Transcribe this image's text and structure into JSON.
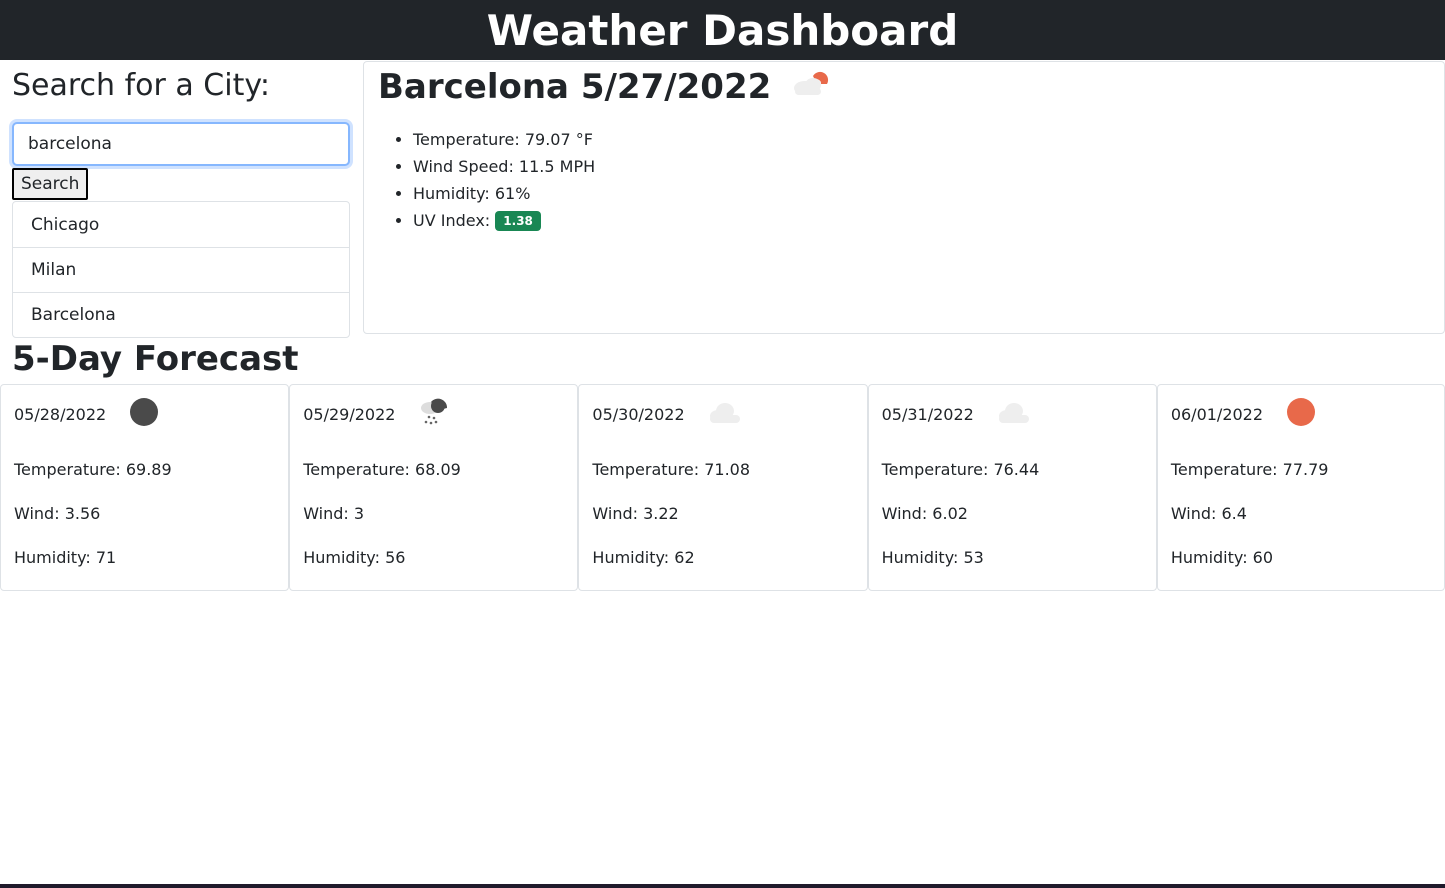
{
  "header": {
    "title": "Weather Dashboard"
  },
  "search": {
    "title": "Search for a City:",
    "value": "barcelona",
    "button_label": "Search"
  },
  "history": [
    "Chicago",
    "Milan",
    "Barcelona"
  ],
  "current": {
    "title": "Barcelona 5/27/2022",
    "icon": "partly-cloudy-icon",
    "temperature": "Temperature: 79.07 °F",
    "wind": "Wind Speed: 11.5 MPH",
    "humidity": "Humidity: 61%",
    "uv_label": "UV Index:",
    "uv_value": "1.38",
    "uv_color": "#198754"
  },
  "forecast": {
    "title": "5-Day Forecast",
    "days": [
      {
        "date": "05/28/2022",
        "icon": "overcast-icon",
        "temperature": "Temperature: 69.89",
        "wind": "Wind: 3.56",
        "humidity": "Humidity: 71"
      },
      {
        "date": "05/29/2022",
        "icon": "snow-icon",
        "temperature": "Temperature: 68.09",
        "wind": "Wind: 3",
        "humidity": "Humidity: 56"
      },
      {
        "date": "05/30/2022",
        "icon": "cloud-icon",
        "temperature": "Temperature: 71.08",
        "wind": "Wind: 3.22",
        "humidity": "Humidity: 62"
      },
      {
        "date": "05/31/2022",
        "icon": "cloud-icon",
        "temperature": "Temperature: 76.44",
        "wind": "Wind: 6.02",
        "humidity": "Humidity: 53"
      },
      {
        "date": "06/01/2022",
        "icon": "sun-icon",
        "temperature": "Temperature: 77.79",
        "wind": "Wind: 6.4",
        "humidity": "Humidity: 60"
      }
    ]
  }
}
